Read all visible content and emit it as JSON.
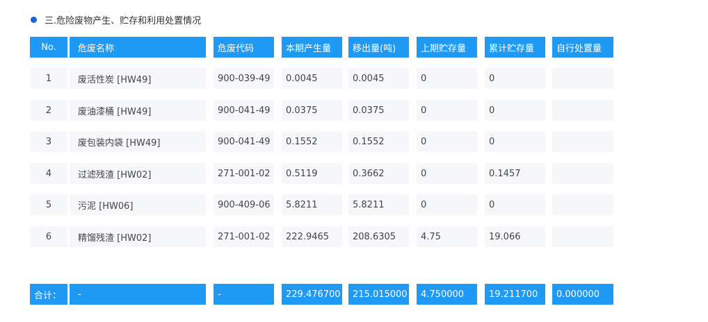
{
  "section": {
    "title": "三.危险废物产生、贮存和利用处置情况"
  },
  "table": {
    "headers": [
      "No.",
      "危废名称",
      "危废代码",
      "本期产生量",
      "移出量(吨)",
      "上期贮存量",
      "累计贮存量",
      "自行处置量"
    ],
    "rows": [
      [
        "1",
        "废活性炭 [HW49]",
        "900-039-49",
        "0.0045",
        "0.0045",
        "0",
        "0",
        ""
      ],
      [
        "2",
        "废油漆桶 [HW49]",
        "900-041-49",
        "0.0375",
        "0.0375",
        "0",
        "0",
        ""
      ],
      [
        "3",
        "废包装内袋 [HW49]",
        "900-041-49",
        "0.1552",
        "0.1552",
        "0",
        "0",
        ""
      ],
      [
        "4",
        "过滤残渣 [HW02]",
        "271-001-02",
        "0.5119",
        "0.3662",
        "0",
        "0.1457",
        ""
      ],
      [
        "5",
        "污泥 [HW06]",
        "900-409-06",
        "5.8211",
        "5.8211",
        "0",
        "0",
        ""
      ],
      [
        "6",
        "精馏残渣 [HW02]",
        "271-001-02",
        "222.9465",
        "208.6305",
        "4.75",
        "19.066",
        ""
      ]
    ],
    "total": [
      "合计：",
      "-",
      "-",
      "229.476700",
      "215.015000",
      "4.750000",
      "19.211700",
      "0.000000"
    ]
  },
  "colors": {
    "header_bg": "#1e9af5",
    "row_bg": "#f5f7fa",
    "bullet": "#1565d8"
  }
}
